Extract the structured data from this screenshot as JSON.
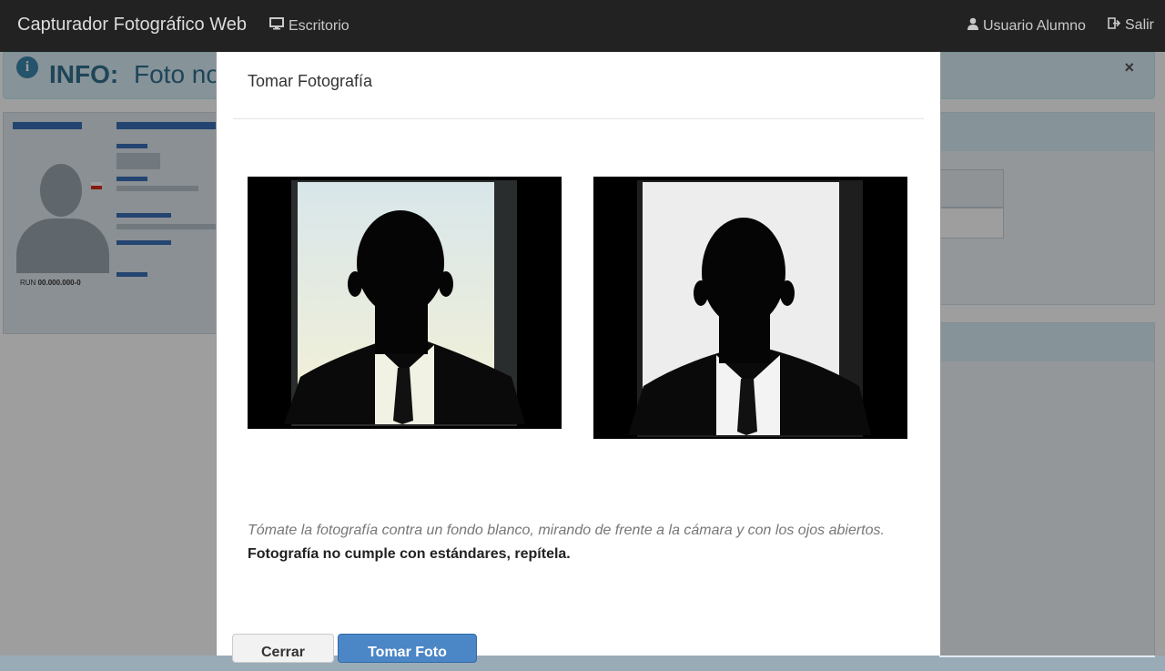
{
  "navbar": {
    "brand": "Capturador Fotográfico Web",
    "desktop": "Escritorio",
    "user": "Usuario Alumno",
    "exit": "Salir"
  },
  "alert": {
    "title": "INFO:",
    "text": "Foto no",
    "close": "×"
  },
  "idcard": {
    "run_label": "RUN",
    "run_value": "00.000.000-0"
  },
  "modal": {
    "title": "Tomar Fotografía",
    "hint": "Tómate la fotografía contra un fondo blanco, mirando de frente a la cámara y con los ojos abiertos.",
    "error": "Fotografía no cumple con estándares, repítela.",
    "close_button": "Cerrar",
    "take_button": "Tomar Foto"
  },
  "colors": {
    "navbar_bg": "#222222",
    "primary_button": "#4b86c6",
    "info_text": "#31708f"
  }
}
